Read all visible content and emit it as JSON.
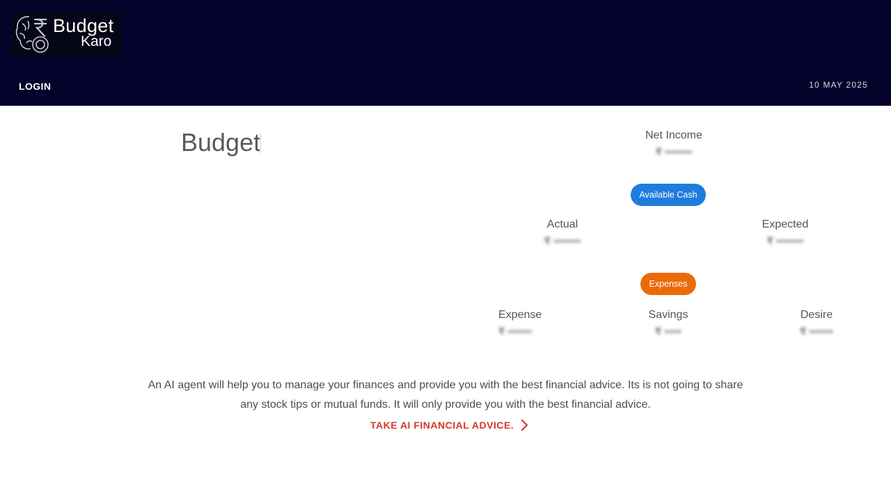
{
  "header": {
    "logo_line1": "Budget",
    "logo_line2": "Karo",
    "login_label": "LOGIN",
    "date": "10 MAY 2025",
    "bg_color": "#02022a"
  },
  "budget": {
    "title": "Budget",
    "net_income": {
      "label": "Net Income",
      "value": "₹ ••••••••"
    },
    "available_cash_label": "Available Cash",
    "actual": {
      "label": "Actual",
      "value": "₹ ••••••••"
    },
    "expected": {
      "label": "Expected",
      "value": "₹ ••••••••"
    },
    "expenses_label": "Expenses",
    "expense": {
      "label": "Expense",
      "value": "₹ •••••••"
    },
    "savings": {
      "label": "Savings",
      "value": "₹ •••••"
    },
    "desire": {
      "label": "Desire",
      "value": "₹ •••••••"
    }
  },
  "advice": {
    "description": "An AI agent will help you to manage your finances and provide you with the best financial advice. Its is not going to share any stock tips or mutual funds. It will only provide you with the best financial advice.",
    "cta_label": "TAKE AI FINANCIAL ADVICE."
  },
  "colors": {
    "accent_blue": "#1e7ddc",
    "accent_orange": "#eb6b08",
    "cta_red": "#d03a2a"
  },
  "icons": {
    "logo": "brain-rupee-logo-icon",
    "cta": "chevron-right-icon"
  }
}
